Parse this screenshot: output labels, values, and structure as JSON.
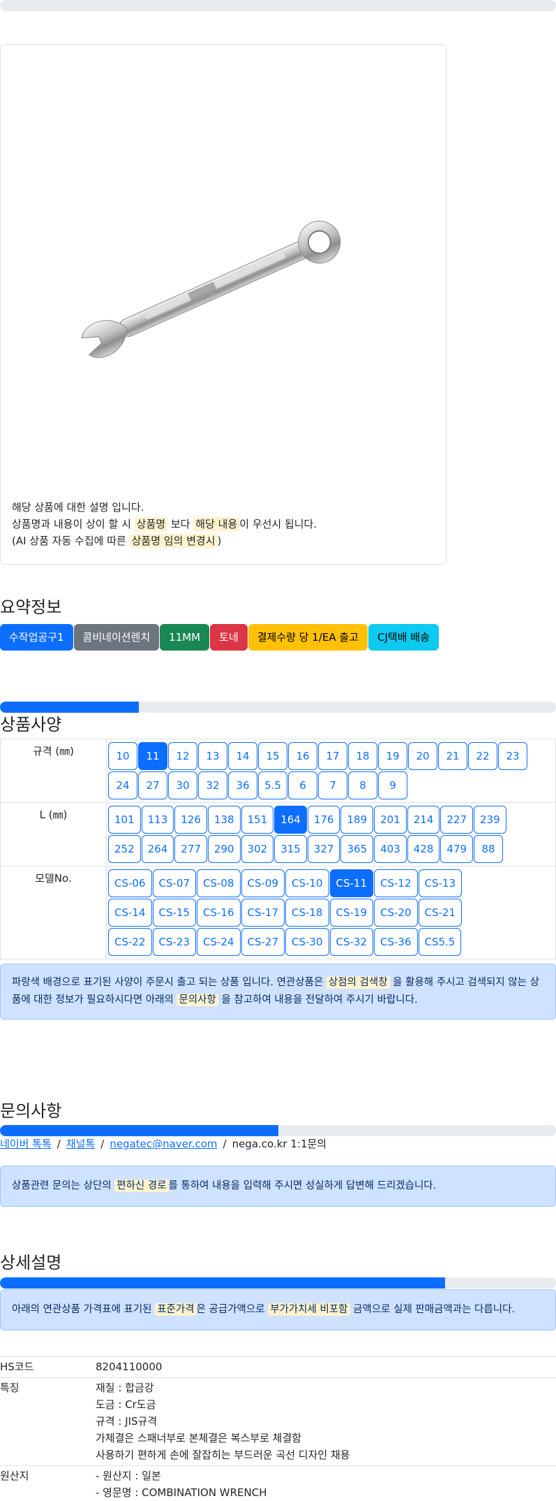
{
  "product": {
    "image_icon": "combination-wrench-image",
    "desc_line1": "해당 상품에 대한 설명 입니다.",
    "desc_line2_pre": "상품명과 내용이 상이 할 시",
    "desc_line2_hl1": "상품명",
    "desc_line2_mid": "보다",
    "desc_line2_hl2": "해당 내용",
    "desc_line2_post": "이 우선시 됩니다.",
    "desc_line3_pre": "(AI 상품 자동 수집에 따른",
    "desc_line3_hl": "상품명 임의 변경시",
    "desc_line3_post": ")"
  },
  "summary": {
    "title": "요약정보",
    "badges": [
      "수작업공구1",
      "콤비네이션렌치",
      "11MM",
      "토네",
      "결제수량 당 1/EA 출고",
      "CJ택배 배송"
    ]
  },
  "spec": {
    "title": "상품사양",
    "progress": 0.25,
    "rows": [
      {
        "label": "규격 (㎜)",
        "lines": [
          [
            "10",
            "11",
            "12",
            "13",
            "14",
            "15",
            "16",
            "17",
            "18",
            "19",
            "20",
            "21",
            "22",
            "23"
          ],
          [
            "24",
            "27",
            "30",
            "32",
            "36",
            "5.5",
            "6",
            "7",
            "8",
            "9"
          ]
        ],
        "selected": "11"
      },
      {
        "label": "L (㎜)",
        "lines": [
          [
            "101",
            "113",
            "126",
            "138",
            "151",
            "164",
            "176",
            "189",
            "201",
            "214",
            "227",
            "239"
          ],
          [
            "252",
            "264",
            "277",
            "290",
            "302",
            "315",
            "327",
            "365",
            "403",
            "428",
            "479",
            "88"
          ]
        ],
        "selected": "164"
      },
      {
        "label": "모델No.",
        "lines": [
          [
            "CS-06",
            "CS-07",
            "CS-08",
            "CS-09",
            "CS-10",
            "CS-11",
            "CS-12",
            "CS-13"
          ],
          [
            "CS-14",
            "CS-15",
            "CS-16",
            "CS-17",
            "CS-18",
            "CS-19",
            "CS-20",
            "CS-21"
          ],
          [
            "CS-22",
            "CS-23",
            "CS-24",
            "CS-27",
            "CS-30",
            "CS-32",
            "CS-36",
            "CS5.5"
          ]
        ],
        "selected": "CS-11"
      }
    ],
    "notice_pre": "파랑색 배경으로 표기된 사양이 주문시 출고 되는 상품 입니다. 연관상품은",
    "notice_hl1": "상점의 검색창",
    "notice_mid": "을 활용해 주시고 검색되지 않는 상품에 대한 정보가 필요하시다면 아래의",
    "notice_hl2": "문의사항",
    "notice_post": "을 참고하여 내용을 전달하여 주시기 바랍니다."
  },
  "inquiry": {
    "title": "문의사항",
    "progress": 0.5,
    "link1": "네이버 톡톡",
    "link2": "채널톡",
    "link3": "negatec@naver.com",
    "plain": "nega.co.kr 1:1문의",
    "sep": "/",
    "notice_pre": "상품관련 문의는 상단의",
    "notice_hl": "편하신 경로",
    "notice_post": "를 통하여 내용을 입력해 주시면 성실하게 답변해 드리겠습니다."
  },
  "detail": {
    "title": "상세설명",
    "progress": 0.8,
    "notice_pre": "아래의 연관상품 가격표에 표기된",
    "notice_hl1": "표준가격",
    "notice_mid": "은 공급가액으로",
    "notice_hl2": "부가가치세 비포함",
    "notice_post": "금액으로 실제 판매금액과는 다릅니다.",
    "rows": [
      {
        "key": "HS코드",
        "values": [
          "8204110000"
        ]
      },
      {
        "key": "특징",
        "values": [
          "재질 : 합금강",
          "도금 : Cr도금",
          "규격 : JIS규격",
          "가체결은 스패너부로 본체결은 복스부로 체결함",
          "사용하기 편하게 손에 잘잡히는 부드러운 곡선 디자인 채용"
        ]
      },
      {
        "key": "원산지",
        "values": [
          "- 원산지 : 일본",
          "- 영문명 : COMBINATION WRENCH"
        ]
      }
    ]
  }
}
